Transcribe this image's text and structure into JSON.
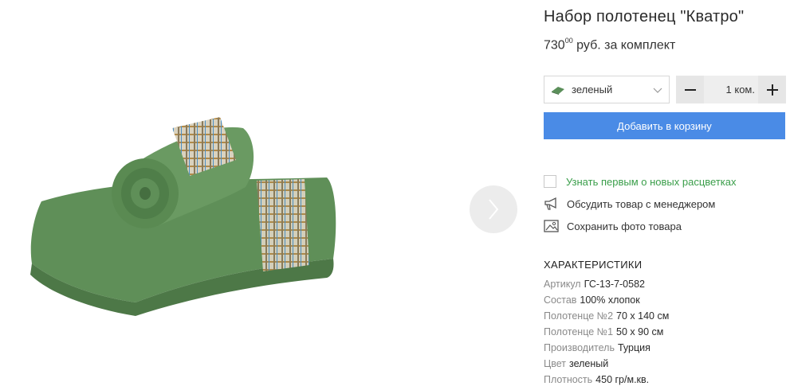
{
  "product": {
    "title": "Набор полотенец \"Кватро\"",
    "price_main": "730",
    "price_cents": "00",
    "price_unit": "руб. за комплект"
  },
  "color_select": {
    "selected": "зеленый",
    "swatch_color": "#5b8f5a",
    "icon": "chevron-down-icon"
  },
  "quantity": {
    "minus_label": "−",
    "value": "1 ком.",
    "plus_label": "+"
  },
  "add_to_cart_label": "Добавить в корзину",
  "actions": {
    "notify_label": "Узнать первым о новых расцветках",
    "discuss_label": "Обсудить товар с менеджером",
    "save_photo_label": "Сохранить фото товара"
  },
  "characteristics": {
    "heading": "ХАРАКТЕРИСТИКИ",
    "items": [
      {
        "key": "Артикул",
        "value": "ГС-13-7-0582"
      },
      {
        "key": "Состав",
        "value": "100% хлопок"
      },
      {
        "key": "Полотенце №2",
        "value": "70 х 140 см"
      },
      {
        "key": "Полотенце №1",
        "value": "50 х 90 см"
      },
      {
        "key": "Производитель",
        "value": "Турция"
      },
      {
        "key": "Цвет",
        "value": "зеленый"
      },
      {
        "key": "Плотность",
        "value": "450 гр/м.кв."
      }
    ]
  },
  "colors": {
    "accent": "#4a8be6",
    "notify_text": "#3a9e4a",
    "towel_green": "#5b8a55"
  }
}
